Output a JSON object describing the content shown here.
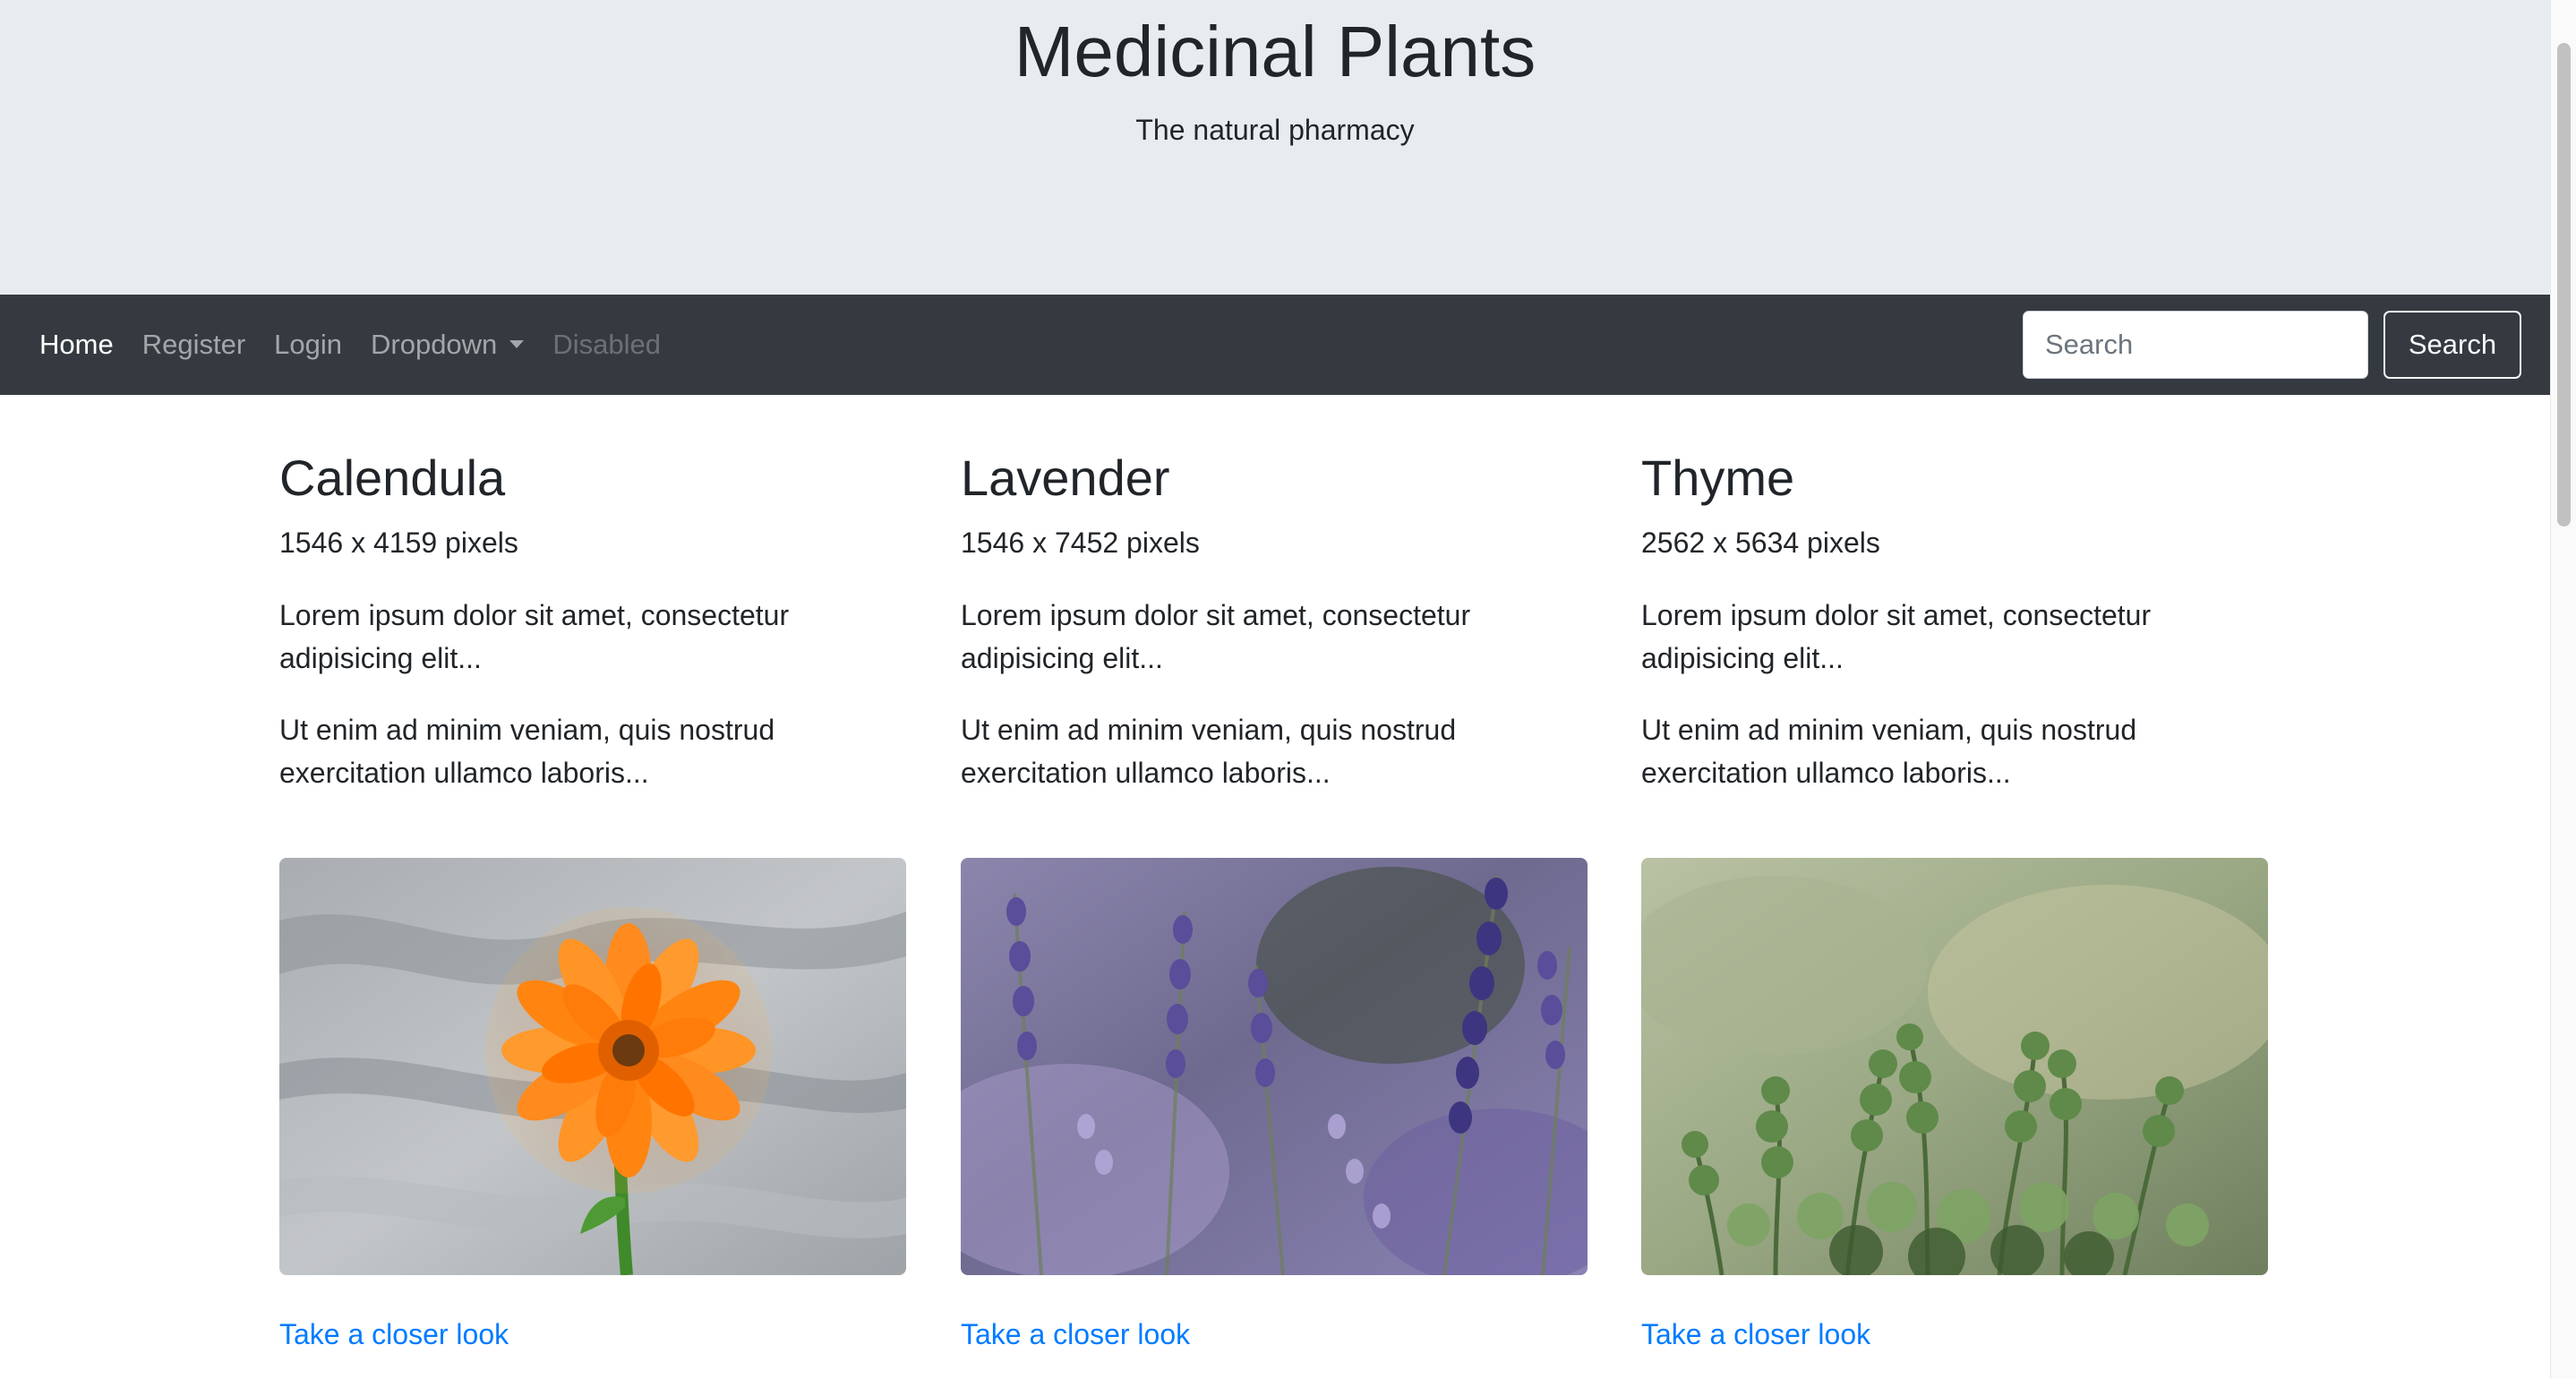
{
  "header": {
    "title": "Medicinal Plants",
    "tagline": "The natural pharmacy"
  },
  "navbar": {
    "links": [
      {
        "label": "Home",
        "state": "active"
      },
      {
        "label": "Register",
        "state": "normal"
      },
      {
        "label": "Login",
        "state": "normal"
      },
      {
        "label": "Dropdown",
        "state": "dropdown"
      },
      {
        "label": "Disabled",
        "state": "disabled"
      }
    ],
    "search": {
      "placeholder": "Search",
      "value": "",
      "button_label": "Search"
    }
  },
  "cards": [
    {
      "title": "Calendula",
      "size": "1546 x 4159 pixels",
      "text1": "Lorem ipsum dolor sit amet, consectetur adipisicing elit...",
      "text2": "Ut enim ad minim veniam, quis nostrud exercitation ullamco laboris...",
      "link": "Take a closer look"
    },
    {
      "title": "Lavender",
      "size": "1546 x 7452 pixels",
      "text1": "Lorem ipsum dolor sit amet, consectetur adipisicing elit...",
      "text2": "Ut enim ad minim veniam, quis nostrud exercitation ullamco laboris...",
      "link": "Take a closer look"
    },
    {
      "title": "Thyme",
      "size": "2562 x 5634 pixels",
      "text1": "Lorem ipsum dolor sit amet, consectetur adipisicing elit...",
      "text2": "Ut enim ad minim veniam, quis nostrud exercitation ullamco laboris...",
      "link": "Take a closer look"
    }
  ],
  "colors": {
    "jumbotron_bg": "#e9ecef",
    "navbar_bg": "#343a40",
    "link": "#007bff",
    "text": "#212529"
  }
}
